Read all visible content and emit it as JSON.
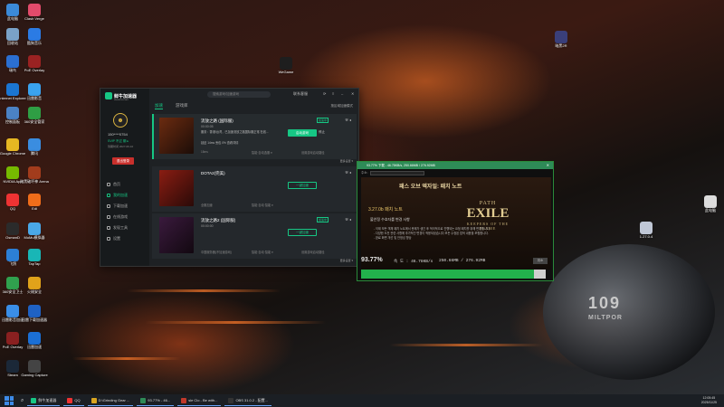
{
  "desktop_icons": [
    {
      "label": "此电脑",
      "color": "#3b8ad9"
    },
    {
      "label": "Clash Verge",
      "color": "#e24b6b"
    },
    {
      "label": "回收站",
      "color": "#7aa2c8"
    },
    {
      "label": "酷狗音乐",
      "color": "#2b7be4"
    },
    {
      "label": "瑞鸟",
      "color": "#2b6fd1"
    },
    {
      "label": "PoE Overlay",
      "color": "#9a2222"
    },
    {
      "label": "Internet Explorer",
      "color": "#1b76d2"
    },
    {
      "label": "迅雷影音",
      "color": "#3aa3ef"
    },
    {
      "label": "控制面板",
      "color": "#4b82c4"
    },
    {
      "label": "360安全管家",
      "color": "#2f9e44"
    },
    {
      "label": "Google Chrome",
      "color": "#e6b722"
    },
    {
      "label": "腾讯",
      "color": "#3a8de0"
    },
    {
      "label": "NVIDIA App",
      "color": "#76b900"
    },
    {
      "label": "暗黑破坏神 Arena",
      "color": "#a23c1c"
    },
    {
      "label": "QQ",
      "color": "#e33"
    },
    {
      "label": "Edi",
      "color": "#f06d1a"
    },
    {
      "label": "OsmanD",
      "color": "#2b2b2b"
    },
    {
      "label": "MuMu模拟器",
      "color": "#4aa8e8"
    },
    {
      "label": "飞鸽",
      "color": "#2c7fd6"
    },
    {
      "label": "TapTap",
      "color": "#19b6b6"
    },
    {
      "label": "360安全卫士",
      "color": "#30a14e"
    },
    {
      "label": "火绒安全",
      "color": "#e0a21a"
    },
    {
      "label": "迅雷影音加速",
      "color": "#3a8ee8"
    },
    {
      "label": "迅雷下载加速器",
      "color": "#1f62c4"
    },
    {
      "label": "PoE Overlay",
      "color": "#8a2020"
    },
    {
      "label": "迅雷加速",
      "color": "#1b6fd5"
    },
    {
      "label": "Steam",
      "color": "#1b2838"
    },
    {
      "label": "Gaming Capture",
      "color": "#444"
    },
    {
      "label": "WeGame",
      "color": "#1e1e1e"
    },
    {
      "label": "暗黑2R",
      "color": "#3a3f7a"
    },
    {
      "label": "此电脑",
      "color": "#ddd"
    },
    {
      "label": "1.27.0.4",
      "color": "#c0c7d6"
    }
  ],
  "launcher": {
    "app_name": "鲜牛加速器",
    "app_sub": "xianniu.com",
    "user": "150****0754",
    "vip": "SVIP 不过 期 ▸",
    "expire": "到期时间 2027-06-10",
    "logout": "退出登录",
    "nav": [
      "首页",
      "我的加速",
      "下载加速",
      "在线游戏",
      "发现工具",
      "设置"
    ],
    "search_placeholder": "搜索游戏/加速游戏",
    "top_feedback": "联系客服",
    "tabs": [
      "加速",
      "游戏库"
    ],
    "mode_link": "按区域加速模式",
    "games": [
      {
        "name": "流放之路 (国际服)",
        "time": "00:00:05",
        "desc": "服务：香港/台湾，已加速流放之路国际服正常 在线...",
        "stats": "延迟 14ms  丢包 0%  查看详情",
        "btn": "启动游戏",
        "stop": "停止",
        "tag": "加速中",
        "server": "智能·自动选服 ▾",
        "meta": "15ms",
        "mode": "设置游戏启动路径",
        "more": "更多设置 ▾"
      },
      {
        "name": "DOTA2(完美)",
        "time": "",
        "desc": "",
        "stats": "",
        "btn": "一键加速",
        "stop": "",
        "tag": "",
        "server": "智能·自动·智能 ▾",
        "meta": "全服加速",
        "mode": "",
        "more": ""
      },
      {
        "name": "流放之路2 (国际服)",
        "time": "00:00:00",
        "desc": "",
        "stats": "",
        "btn": "一键加速",
        "stop": "",
        "tag": "加速中",
        "server": "智能·自动·智能 ▾",
        "meta": "中国服务器(不加速游戏)",
        "mode": "设置游戏启动路径",
        "more": "更多设置 ▾"
      }
    ]
  },
  "patcher": {
    "title": "93.77% 下载 - 46.78KB/s, 250.66MB / 276.92MB",
    "url_label": "주소:",
    "heading": "패스 오브 엑자일: 패치 노트",
    "version": "3.27.0b 패치 노트",
    "intro": "불안정 수호자를 변경 사항",
    "list": [
      "- 이제 모든 객체 패치 노트에서 문제가 생긴 후 적극적으로 진행되는 요청 패치를 위해 변경합니다.",
      "- 다양한 도전 관련 사항에 추가적인 변경이 적용되었습니다 모든 수정된 업적 내용을 포함합니다.",
      "- 완료 화면 개선 및 안정성 향상"
    ],
    "logo_top": "PATH",
    "logo_mid": "EXILE",
    "logo_sub": "KEEPERS OF THE FLAME",
    "percent": "93.77%",
    "speed": "속 도 : 46.78KB/s",
    "loaded": "250.66MB / 276.92MB",
    "cancel": "취소",
    "progress": 0.9377
  },
  "deco": {
    "model": "109",
    "brand": "MILTPOR"
  },
  "taskbar": {
    "items": [
      "鲜牛加速器",
      "QQ",
      "D:\\Grinding Gear ...",
      "93.77% - 46...",
      "sle Clo - Be with...",
      "OBS 31.0.2 - 配置..."
    ],
    "time": "12:05:45",
    "date": "2025/11/25"
  }
}
